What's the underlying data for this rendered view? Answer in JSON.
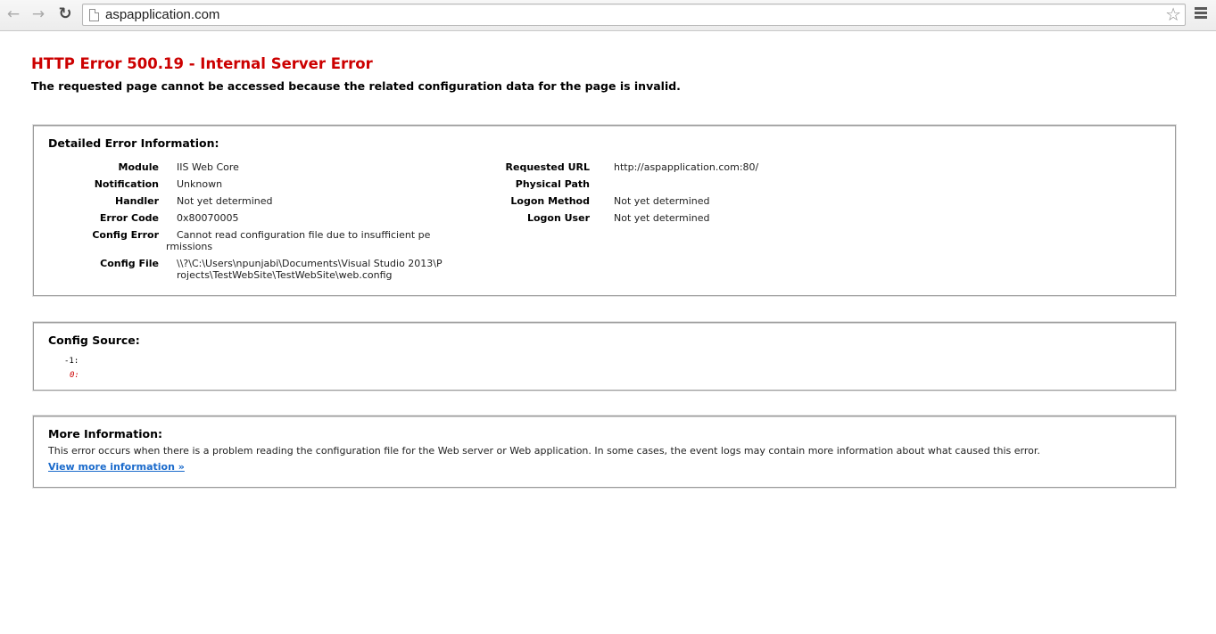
{
  "browser": {
    "url": "aspapplication.com",
    "back_icon": "back-arrow-icon",
    "forward_icon": "forward-arrow-icon",
    "reload_icon": "reload-icon"
  },
  "error": {
    "title": "HTTP Error 500.19 - Internal Server Error",
    "subtitle": "The requested page cannot be accessed because the related configuration data for the page is invalid."
  },
  "detailed": {
    "heading": "Detailed Error Information:",
    "left": [
      {
        "label": "Module",
        "value": "IIS Web Core"
      },
      {
        "label": "Notification",
        "value": "Unknown"
      },
      {
        "label": "Handler",
        "value": "Not yet determined"
      },
      {
        "label": "Error Code",
        "value": "0x80070005"
      },
      {
        "label": "Config Error",
        "value": "Cannot read configuration file due to insufficient pe rmissions"
      },
      {
        "label": "Config File",
        "value": "\\\\?\\C:\\Users\\npunjabi\\Documents\\Visual Studio 2013\\Projects\\TestWebSite\\TestWebSite\\web.config"
      }
    ],
    "right": [
      {
        "label": "Requested URL",
        "value": "http://aspapplication.com:80/"
      },
      {
        "label": "Physical Path",
        "value": ""
      },
      {
        "label": "Logon Method",
        "value": "Not yet determined"
      },
      {
        "label": "Logon User",
        "value": "Not yet determined"
      }
    ]
  },
  "config_source": {
    "heading": "Config Source:",
    "line1": "-1:",
    "line2": "0:"
  },
  "more_info": {
    "heading": "More Information:",
    "text": "This error occurs when there is a problem reading the configuration file for the Web server or Web application. In some cases, the event logs may contain more information about what caused this error.",
    "link": "View more information »"
  },
  "colors": {
    "title_red": "#cc0000",
    "link_blue": "#1a6acb"
  }
}
